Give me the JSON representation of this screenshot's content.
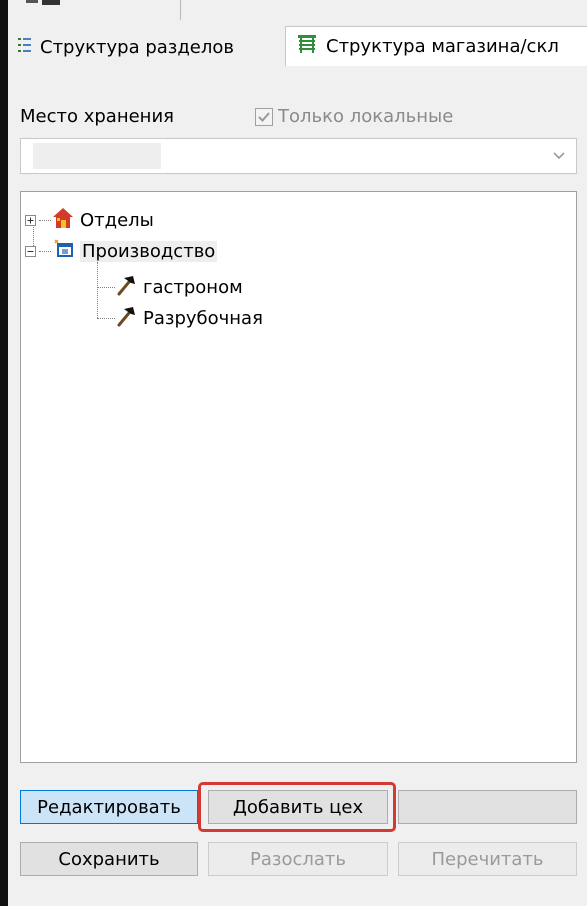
{
  "tabs": [
    {
      "label": "Структура разделов",
      "icon": "structure-list-icon",
      "active": false
    },
    {
      "label": "Структура магазина/скл",
      "icon": "shop-structure-icon",
      "active": true
    }
  ],
  "storage": {
    "label": "Место хранения",
    "local_only_label": "Только локальные",
    "local_only_checked": true,
    "local_only_enabled": false
  },
  "tree": {
    "nodes": [
      {
        "label": "Отделы",
        "icon": "house-icon",
        "expander": "+"
      },
      {
        "label": "Производство",
        "icon": "production-window-icon",
        "expander": "−"
      },
      {
        "label": "гастроном",
        "icon": "hammer-icon"
      },
      {
        "label": "Разрубочная",
        "icon": "hammer-icon"
      }
    ]
  },
  "buttons": {
    "edit": "Редактировать",
    "add_workshop": "Добавить цех",
    "save": "Сохранить",
    "send": "Разослать",
    "reread": "Перечитать"
  },
  "colors": {
    "highlight": "#d43a33",
    "selected_button": "#cce4f7"
  }
}
